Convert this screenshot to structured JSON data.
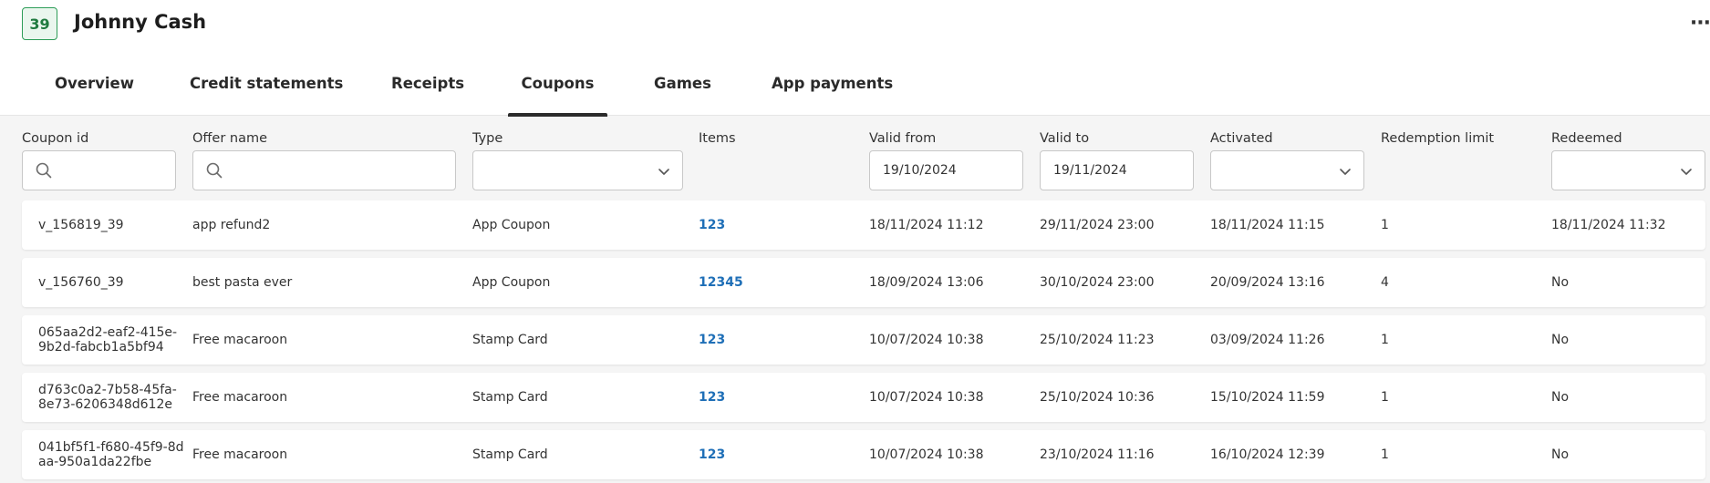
{
  "customer": {
    "number": "39",
    "name": "Johnny Cash",
    "more_label": "···"
  },
  "tabs": [
    {
      "label": "Overview"
    },
    {
      "label": "Credit statements"
    },
    {
      "label": "Receipts"
    },
    {
      "label": "Coupons",
      "active": true
    },
    {
      "label": "Games"
    },
    {
      "label": "App payments"
    }
  ],
  "columns": {
    "coupon_id": "Coupon id",
    "offer_name": "Offer name",
    "type": "Type",
    "items": "Items",
    "valid_from": "Valid from",
    "valid_to": "Valid to",
    "activated": "Activated",
    "redemption_limit": "Redemption limit",
    "redeemed": "Redeemed"
  },
  "filters": {
    "coupon_id": "",
    "offer_name": "",
    "type": "",
    "valid_from": "19/10/2024",
    "valid_to": "19/11/2024",
    "activated": "",
    "redeemed": ""
  },
  "rows": [
    {
      "coupon_id": "v_156819_39",
      "offer_name": "app refund2",
      "type": "App Coupon",
      "items": "123",
      "valid_from": "18/11/2024 11:12",
      "valid_to": "29/11/2024 23:00",
      "activated": "18/11/2024 11:15",
      "redemption_limit": "1",
      "redeemed": "18/11/2024 11:32"
    },
    {
      "coupon_id": "v_156760_39",
      "offer_name": "best pasta ever",
      "type": "App Coupon",
      "items": "12345",
      "valid_from": "18/09/2024 13:06",
      "valid_to": "30/10/2024 23:00",
      "activated": "20/09/2024 13:16",
      "redemption_limit": "4",
      "redeemed": "No"
    },
    {
      "coupon_id": "065aa2d2-eaf2-415e-9b2d-fabcb1a5bf94",
      "offer_name": "Free macaroon",
      "type": "Stamp Card",
      "items": "123",
      "valid_from": "10/07/2024 10:38",
      "valid_to": "25/10/2024 11:23",
      "activated": "03/09/2024 11:26",
      "redemption_limit": "1",
      "redeemed": "No"
    },
    {
      "coupon_id": "d763c0a2-7b58-45fa-8e73-6206348d612e",
      "offer_name": "Free macaroon",
      "type": "Stamp Card",
      "items": "123",
      "valid_from": "10/07/2024 10:38",
      "valid_to": "25/10/2024 10:36",
      "activated": "15/10/2024 11:59",
      "redemption_limit": "1",
      "redeemed": "No"
    },
    {
      "coupon_id": "041bf5f1-f680-45f9-8daa-950a1da22fbe",
      "offer_name": "Free macaroon",
      "type": "Stamp Card",
      "items": "123",
      "valid_from": "10/07/2024 10:38",
      "valid_to": "23/10/2024 11:16",
      "activated": "16/10/2024 12:39",
      "redemption_limit": "1",
      "redeemed": "No"
    }
  ],
  "icons": {
    "search": "search-icon",
    "chevron": "chevron-down-icon",
    "more": "more-horizontal-icon"
  },
  "colors": {
    "badge_border": "#2e9d58",
    "badge_bg": "#eaf6ee",
    "link": "#1f6fb7",
    "active_tab_underline": "#2b2b2b"
  }
}
